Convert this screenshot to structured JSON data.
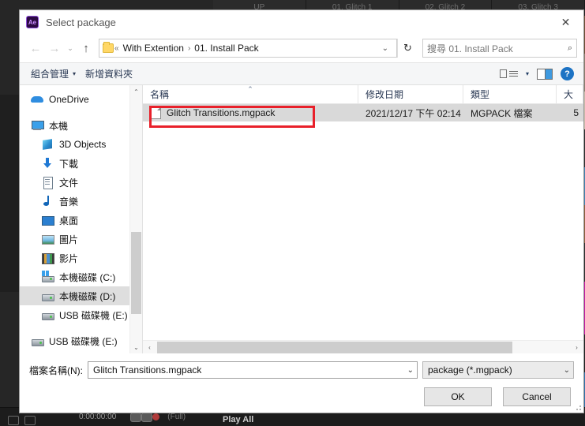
{
  "background": {
    "tabs": [
      "UP",
      "01. Glitch 1",
      "02. Glitch 2",
      "03. Glitch 3"
    ],
    "timecode": "0:00:00:00",
    "resolution": "(Full)",
    "play_all": "Play All",
    "thumb_colors": [
      "#6b4a32",
      "#8a7a6a",
      "#c9b9a8",
      "#2a2a2a",
      "#3f7fae",
      "#8a5a3a",
      "#2a2a2a",
      "#c0189e",
      "#1c1c1c",
      "#2f6fa8"
    ]
  },
  "dialog": {
    "title": "Select package",
    "app_badge": "Ae",
    "close_icon": "✕",
    "nav": {
      "back_icon": "←",
      "forward_icon": "→",
      "history_icon": "⌄",
      "up_icon": "↑",
      "breadcrumb": {
        "prefix": "«",
        "separator": "›",
        "items": [
          "With Extention",
          "01. Install Pack"
        ]
      },
      "address_caret": "⌄",
      "refresh_icon": "↻",
      "search_placeholder": "搜尋 01. Install Pack",
      "search_icon": "⌕"
    },
    "commandbar": {
      "organize": "組合管理",
      "organize_caret": "▾",
      "new_folder": "新增資料夾",
      "view_caret": "▾",
      "help_glyph": "?"
    },
    "sidebar": {
      "items": [
        {
          "label": "OneDrive",
          "icon": "cloud-icon",
          "indent": false,
          "selected": false,
          "gap": false
        },
        {
          "label": "本機",
          "icon": "computer-icon",
          "indent": false,
          "selected": false,
          "gap": true
        },
        {
          "label": "3D Objects",
          "icon": "3d-objects-icon",
          "indent": true,
          "selected": false,
          "gap": false
        },
        {
          "label": "下載",
          "icon": "downloads-icon",
          "indent": true,
          "selected": false,
          "gap": false
        },
        {
          "label": "文件",
          "icon": "documents-icon",
          "indent": true,
          "selected": false,
          "gap": false
        },
        {
          "label": "音樂",
          "icon": "music-icon",
          "indent": true,
          "selected": false,
          "gap": false
        },
        {
          "label": "桌面",
          "icon": "desktop-icon",
          "indent": true,
          "selected": false,
          "gap": false
        },
        {
          "label": "圖片",
          "icon": "pictures-icon",
          "indent": true,
          "selected": false,
          "gap": false
        },
        {
          "label": "影片",
          "icon": "videos-icon",
          "indent": true,
          "selected": false,
          "gap": false
        },
        {
          "label": "本機磁碟 (C:)",
          "icon": "windows-drive-icon",
          "indent": true,
          "selected": false,
          "gap": false
        },
        {
          "label": "本機磁碟 (D:)",
          "icon": "drive-icon",
          "indent": true,
          "selected": true,
          "gap": false
        },
        {
          "label": "USB 磁碟機 (E:)",
          "icon": "usb-drive-icon",
          "indent": true,
          "selected": false,
          "gap": false
        },
        {
          "label": "USB 磁碟機 (E:)",
          "icon": "usb-drive-icon",
          "indent": false,
          "selected": false,
          "gap": true
        }
      ],
      "scroll_up_icon": "⌃",
      "scroll_down_icon": "⌄"
    },
    "filelist": {
      "columns": [
        {
          "key": "name",
          "label": "名稱",
          "sorted": true,
          "sort_icon": "⌃"
        },
        {
          "key": "date",
          "label": "修改日期",
          "sorted": false,
          "sort_icon": ""
        },
        {
          "key": "type",
          "label": "類型",
          "sorted": false,
          "sort_icon": ""
        },
        {
          "key": "size",
          "label": "大",
          "sorted": false,
          "sort_icon": ""
        }
      ],
      "rows": [
        {
          "name": "Glitch Transitions.mgpack",
          "date": "2021/12/17 下午 02:14",
          "type": "MGPACK 檔案",
          "size": "5",
          "selected": true,
          "annotated": true
        }
      ],
      "hscroll_left_icon": "‹",
      "hscroll_right_icon": "›"
    },
    "footer": {
      "filename_label": "檔案名稱(N):",
      "filename_value": "Glitch Transitions.mgpack",
      "filename_caret": "⌄",
      "filter_value": "package (*.mgpack)",
      "filter_caret": "⌄",
      "ok_label": "OK",
      "cancel_label": "Cancel"
    },
    "annotation_color": "#e8202a"
  }
}
